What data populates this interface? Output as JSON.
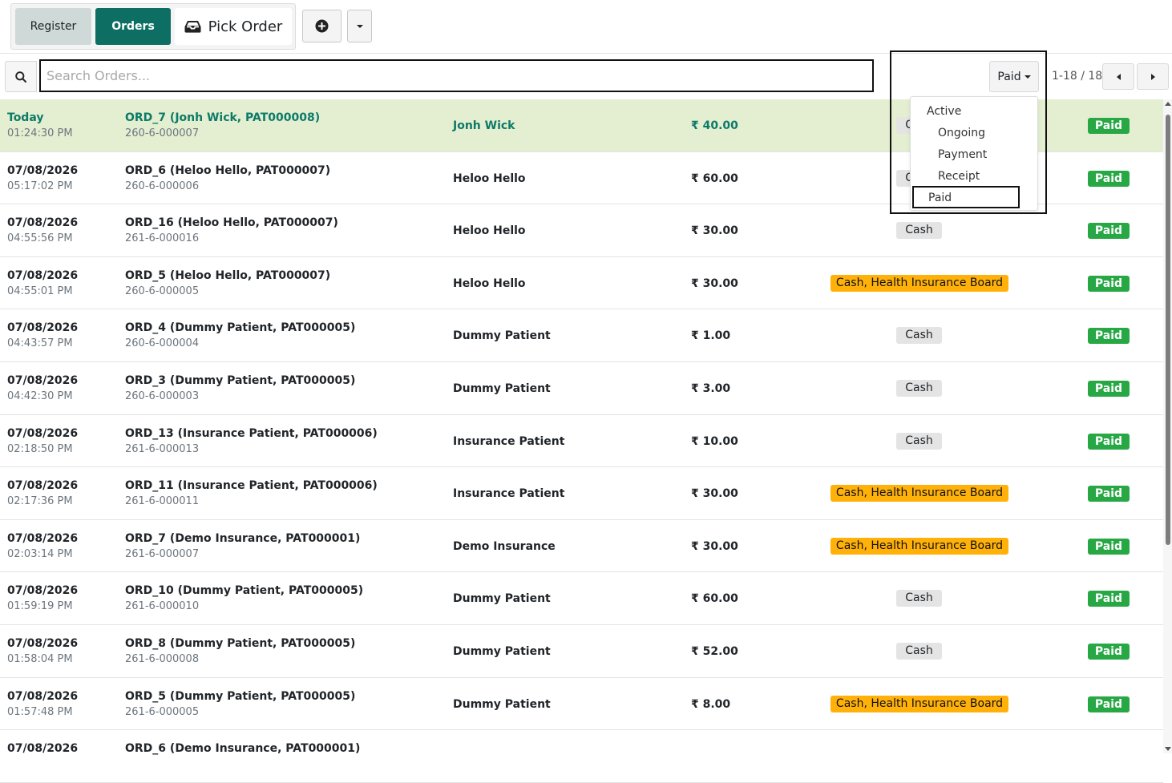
{
  "toolbar": {
    "register_label": "Register",
    "orders_label": "Orders",
    "pick_order_label": "Pick Order"
  },
  "search": {
    "placeholder": "Search Orders...",
    "value": ""
  },
  "filter": {
    "selected": "Paid",
    "options": [
      "Active",
      "Ongoing",
      "Payment",
      "Receipt",
      "Paid"
    ]
  },
  "pager": {
    "range_label": "1-18 / 18"
  },
  "currency_symbol": "₹",
  "colors": {
    "accent": "#0d6e63",
    "highlight_row": "#e4efd2",
    "paid_badge": "#28a745",
    "insurance_badge": "#ffb10a",
    "cash_badge": "#e4e4e4"
  },
  "orders": [
    {
      "date": "Today",
      "time": "01:24:30 PM",
      "order": "ORD_7 (Jonh Wick, PAT000008)",
      "code": "260-6-000007",
      "patient": "Jonh Wick",
      "amount": "40.00",
      "payment": "Cash",
      "status": "Paid",
      "highlighted": true
    },
    {
      "date": "07/08/2026",
      "time": "05:17:02 PM",
      "order": "ORD_6 (Heloo Hello, PAT000007)",
      "code": "260-6-000006",
      "patient": "Heloo Hello",
      "amount": "60.00",
      "payment": "Cash",
      "status": "Paid"
    },
    {
      "date": "07/08/2026",
      "time": "04:55:56 PM",
      "order": "ORD_16 (Heloo Hello, PAT000007)",
      "code": "261-6-000016",
      "patient": "Heloo Hello",
      "amount": "30.00",
      "payment": "Cash",
      "status": "Paid"
    },
    {
      "date": "07/08/2026",
      "time": "04:55:01 PM",
      "order": "ORD_5 (Heloo Hello, PAT000007)",
      "code": "260-6-000005",
      "patient": "Heloo Hello",
      "amount": "30.00",
      "payment": "Cash, Health Insurance Board",
      "status": "Paid"
    },
    {
      "date": "07/08/2026",
      "time": "04:43:57 PM",
      "order": "ORD_4 (Dummy Patient, PAT000005)",
      "code": "260-6-000004",
      "patient": "Dummy Patient",
      "amount": "1.00",
      "payment": "Cash",
      "status": "Paid"
    },
    {
      "date": "07/08/2026",
      "time": "04:42:30 PM",
      "order": "ORD_3 (Dummy Patient, PAT000005)",
      "code": "260-6-000003",
      "patient": "Dummy Patient",
      "amount": "3.00",
      "payment": "Cash",
      "status": "Paid"
    },
    {
      "date": "07/08/2026",
      "time": "02:18:50 PM",
      "order": "ORD_13 (Insurance Patient, PAT000006)",
      "code": "261-6-000013",
      "patient": "Insurance Patient",
      "amount": "10.00",
      "payment": "Cash",
      "status": "Paid"
    },
    {
      "date": "07/08/2026",
      "time": "02:17:36 PM",
      "order": "ORD_11 (Insurance Patient, PAT000006)",
      "code": "261-6-000011",
      "patient": "Insurance Patient",
      "amount": "30.00",
      "payment": "Cash, Health Insurance Board",
      "status": "Paid"
    },
    {
      "date": "07/08/2026",
      "time": "02:03:14 PM",
      "order": "ORD_7 (Demo Insurance, PAT000001)",
      "code": "261-6-000007",
      "patient": "Demo Insurance",
      "amount": "30.00",
      "payment": "Cash, Health Insurance Board",
      "status": "Paid"
    },
    {
      "date": "07/08/2026",
      "time": "01:59:19 PM",
      "order": "ORD_10 (Dummy Patient, PAT000005)",
      "code": "261-6-000010",
      "patient": "Dummy Patient",
      "amount": "60.00",
      "payment": "Cash",
      "status": "Paid"
    },
    {
      "date": "07/08/2026",
      "time": "01:58:04 PM",
      "order": "ORD_8 (Dummy Patient, PAT000005)",
      "code": "261-6-000008",
      "patient": "Dummy Patient",
      "amount": "52.00",
      "payment": "Cash",
      "status": "Paid"
    },
    {
      "date": "07/08/2026",
      "time": "01:57:48 PM",
      "order": "ORD_5 (Dummy Patient, PAT000005)",
      "code": "261-6-000005",
      "patient": "Dummy Patient",
      "amount": "8.00",
      "payment": "Cash, Health Insurance Board",
      "status": "Paid"
    },
    {
      "date": "07/08/2026",
      "time": "",
      "order": "ORD_6 (Demo Insurance, PAT000001)",
      "code": "",
      "patient": "",
      "amount": "",
      "payment": "",
      "status": ""
    }
  ]
}
